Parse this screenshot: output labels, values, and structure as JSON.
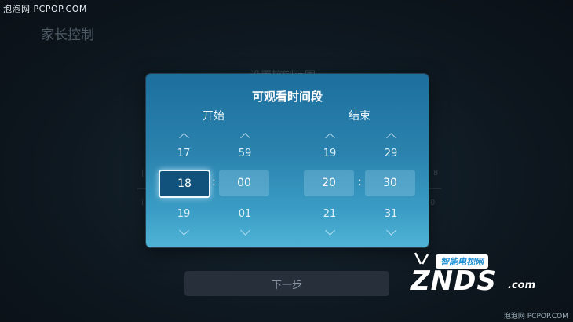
{
  "watermark": {
    "top": "泡泡网 PCPOP.COM",
    "bottom": "泡泡网 PCPOP.COM"
  },
  "page": {
    "title": "家长控制",
    "subtitle": "设置控制范围",
    "side_right_1": "8",
    "side_right_2": "0",
    "side_left_1": "|",
    "side_left_2": "i"
  },
  "dialog": {
    "title": "可观看时间段",
    "start_label": "开始",
    "end_label": "结束",
    "start_hour": {
      "prev": "17",
      "current": "18",
      "next": "19"
    },
    "start_minute": {
      "prev": "59",
      "current": "00",
      "next": "01"
    },
    "end_hour": {
      "prev": "19",
      "current": "20",
      "next": "21"
    },
    "end_minute": {
      "prev": "29",
      "current": "30",
      "next": "31"
    },
    "separator": ":"
  },
  "footer": {
    "next_label": "下一步"
  },
  "logo": {
    "badge": "智能电视网",
    "main": "ZNDS",
    "suffix": ".com"
  }
}
